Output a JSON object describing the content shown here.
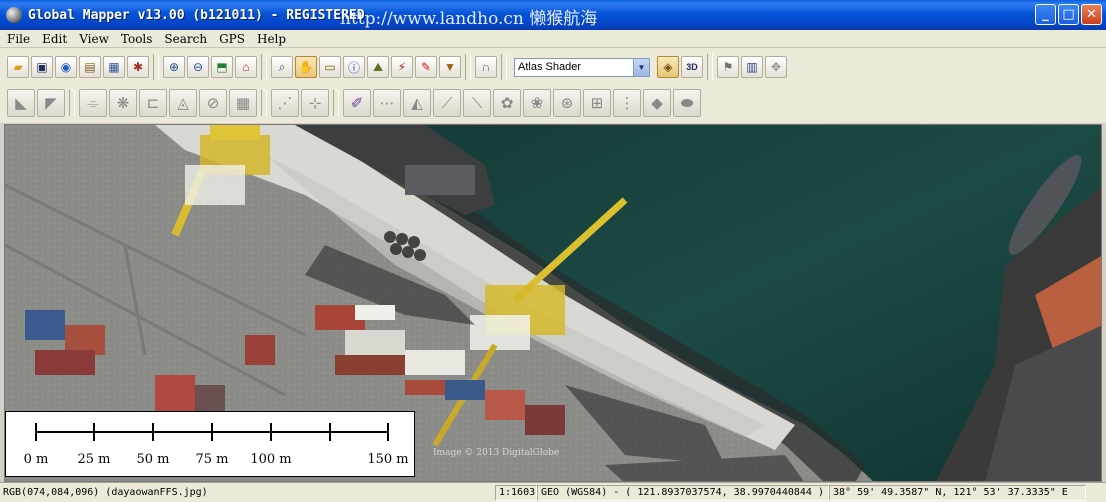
{
  "window": {
    "title": "Global Mapper v13.00 (b121011) - REGISTERED",
    "watermark": "http://www.landho.cn  懒猴航海"
  },
  "menu": {
    "items": [
      "File",
      "Edit",
      "View",
      "Tools",
      "Search",
      "GPS",
      "Help"
    ]
  },
  "toolbar": {
    "shader_selected": "Atlas Shader",
    "row1_icons": [
      "open-folder-icon",
      "save-icon",
      "globe-icon",
      "catalog-icon",
      "config-icon",
      "tools-icon"
    ],
    "row1_nav_icons": [
      "zoom-in-icon",
      "zoom-out-icon",
      "full-view-icon",
      "home-icon"
    ],
    "row1_tool_icons": [
      "zoom-tool-icon",
      "pan-tool-icon",
      "measure-icon",
      "info-icon",
      "path-profile-icon",
      "tower-icon",
      "draw-icon",
      "dropdown-icon",
      "arch-icon"
    ],
    "view3d_label": "3D",
    "row2_icons": [
      "edit-1-icon",
      "edit-2-icon",
      "edit-3-icon",
      "edit-4-icon",
      "edit-5-icon",
      "edit-6-icon",
      "edit-7-icon",
      "edit-8-icon",
      "edit-9-icon",
      "edit-10-icon",
      "edit-11-icon",
      "edit-12-icon",
      "edit-13-icon",
      "edit-14-icon",
      "edit-15-icon",
      "edit-16-icon",
      "edit-17-icon",
      "edit-18-icon",
      "edit-19-icon",
      "edit-20-icon",
      "edit-21-icon",
      "edit-22-icon",
      "edit-23-icon",
      "edit-24-icon"
    ]
  },
  "map": {
    "copyright": "Image © 2013 DigitalGlobe"
  },
  "scalebar": {
    "labels": [
      "0 m",
      "25 m",
      "50 m",
      "75 m",
      "100 m",
      "150 m"
    ]
  },
  "status": {
    "pixel": "RGB(074,084,096) (dayaowanFFS.jpg)",
    "scale": "1:1603",
    "coords": "GEO (WGS84) - ( 121.8937037574, 38.9970440844 )",
    "dms": "38° 59' 49.3587\" N, 121° 53' 37.3335\" E"
  }
}
